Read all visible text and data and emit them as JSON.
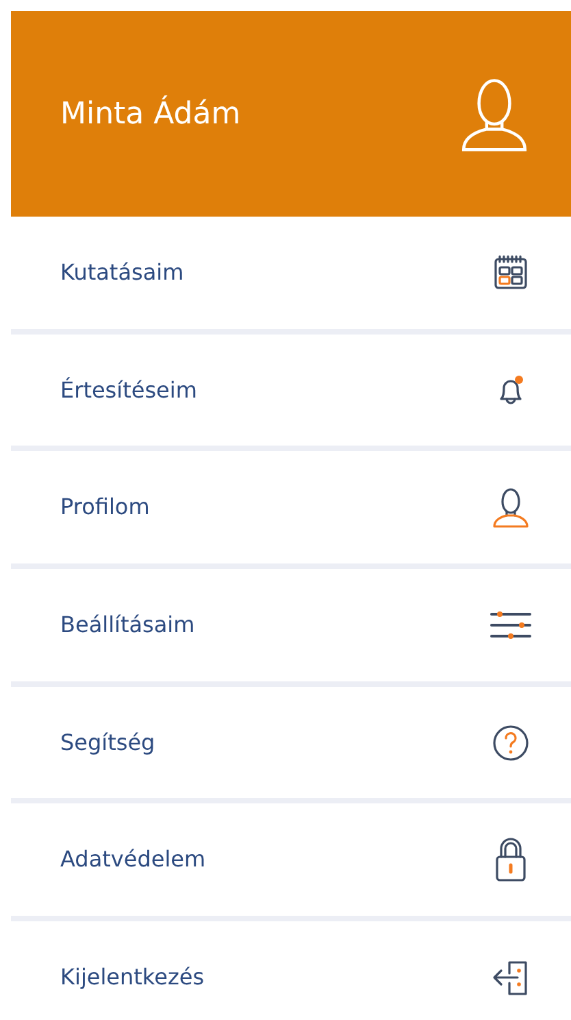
{
  "header": {
    "name": "Minta Ádám"
  },
  "menu": [
    {
      "label": "Kutatásaim",
      "kind": "calendar"
    },
    {
      "label": "Értesítéseim",
      "kind": "bell"
    },
    {
      "label": "Profilom",
      "kind": "person"
    },
    {
      "label": "Beállításaim",
      "kind": "sliders"
    },
    {
      "label": "Segítség",
      "kind": "help"
    },
    {
      "label": "Adatvédelem",
      "kind": "lock"
    },
    {
      "label": "Kijelentkezés",
      "kind": "logout"
    }
  ]
}
